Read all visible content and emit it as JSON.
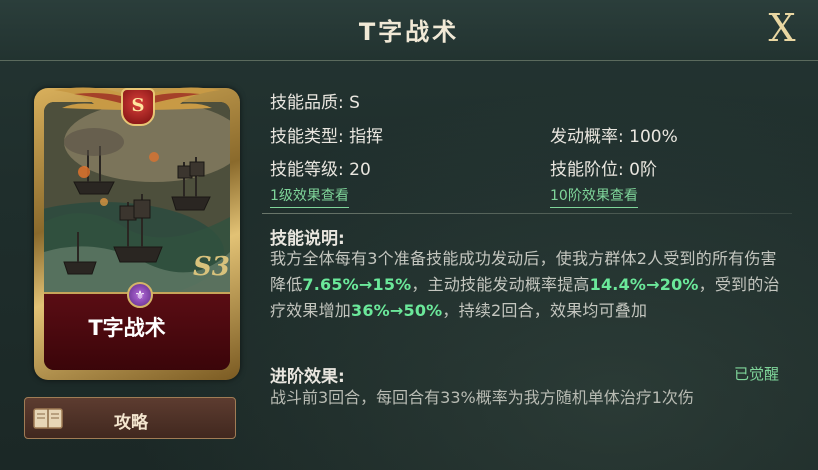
{
  "header": {
    "title": "T字战术",
    "close_label": "X"
  },
  "card": {
    "name": "T字战术",
    "grade_badge": "S",
    "corner_badge": "S3",
    "gem_icon": "emblem-icon"
  },
  "guide_button": {
    "label": "攻略",
    "icon": "book-icon"
  },
  "skill": {
    "quality": {
      "key": "技能品质:",
      "value": "S"
    },
    "type": {
      "key": "技能类型:",
      "value": "指挥"
    },
    "trigger_rate": {
      "key": "发动概率:",
      "value": "100%"
    },
    "level": {
      "key": "技能等级:",
      "value": "20"
    },
    "tier": {
      "key": "技能阶位:",
      "value": "0阶"
    },
    "link_level1": "1级效果查看",
    "link_tier10": "10阶效果查看"
  },
  "description": {
    "title": "技能说明:",
    "p1": "我方全体每有3个准备技能成功发动后，使我方群体2人受到的所有伤害降低",
    "h1": "7.65%→15%",
    "p2": "，主动技能发动概率提高",
    "h2": "14.4%→20%",
    "p3": "，受到的治疗效果增加",
    "h3": "36%→50%",
    "p4": "，持续2回合，效果均可叠加"
  },
  "advanced": {
    "title": "进阶效果:",
    "status": "已觉醒",
    "text": "战斗前3回合，每回合有33%概率为我方随机单体治疗1次伤"
  },
  "colors": {
    "background": "#1f2e2c",
    "highlight_green": "#6be89a",
    "card_name_red": "#5a0d14",
    "gold": "#d9b05c"
  }
}
